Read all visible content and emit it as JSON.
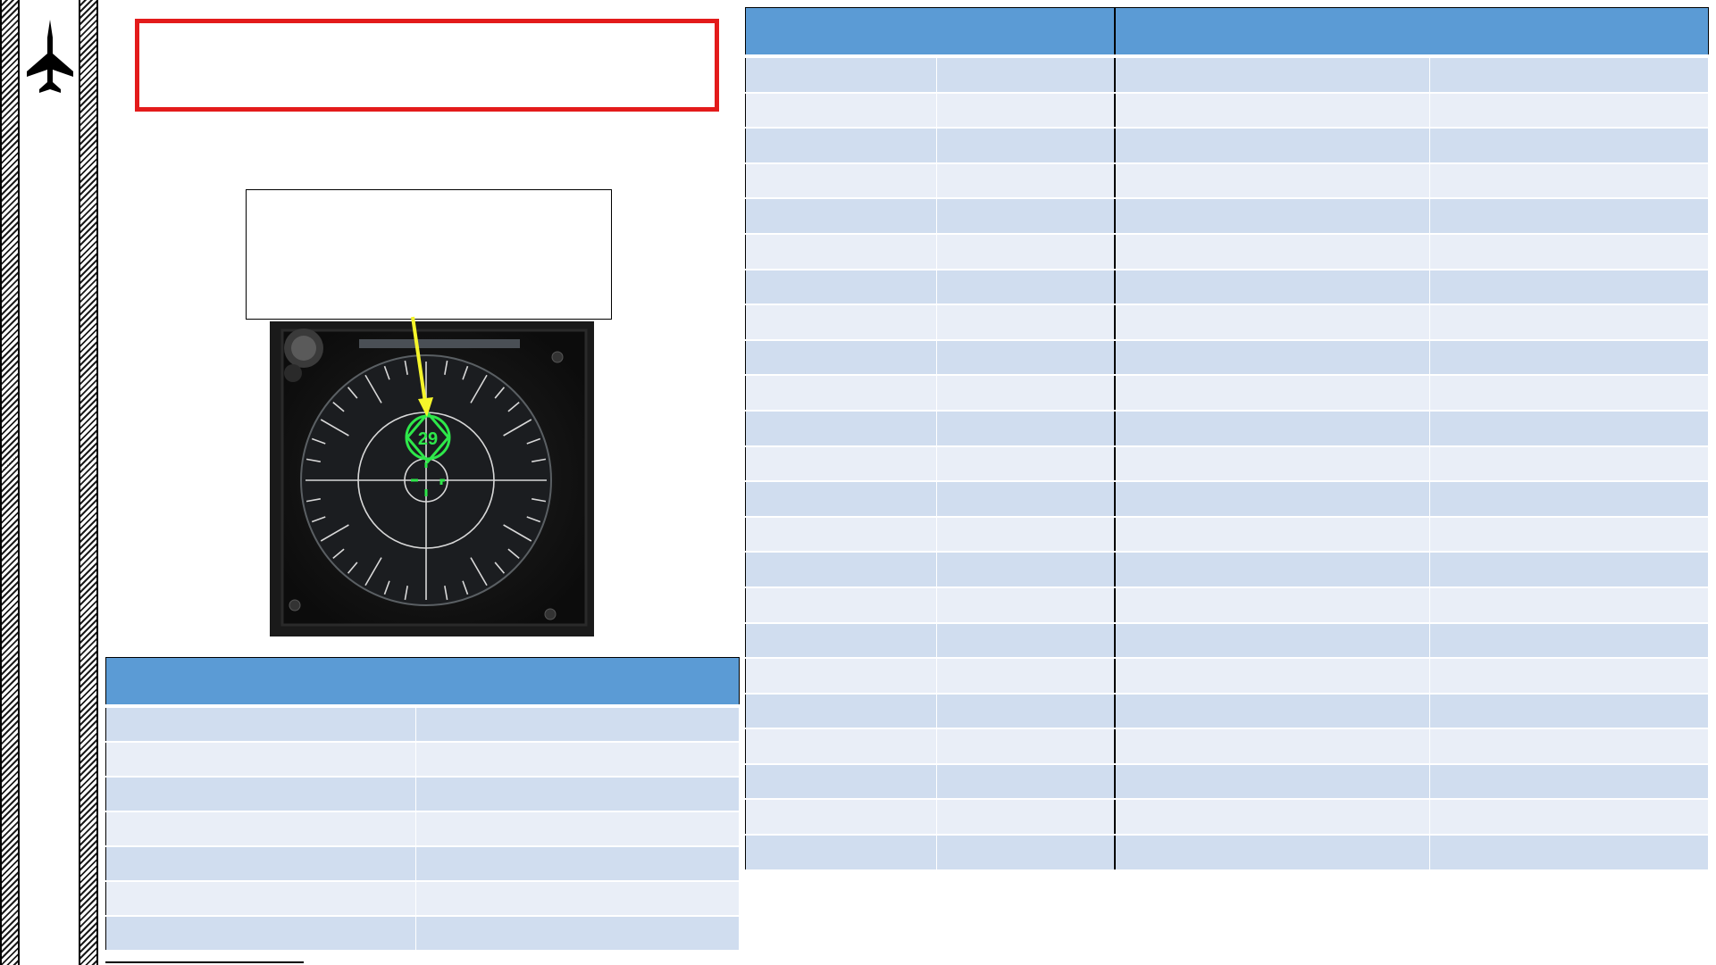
{
  "page": {
    "title": "",
    "callout_text": ""
  },
  "instrument": {
    "name": "radar-indicator",
    "target_symbol_value": "29",
    "screen_color": "#141414",
    "symbol_color": "#2ee84a",
    "pointer_color": "#f5f52a"
  },
  "bottom_table": {
    "header": "",
    "rows": [
      [
        "",
        ""
      ],
      [
        "",
        ""
      ],
      [
        "",
        ""
      ],
      [
        "",
        ""
      ],
      [
        "",
        ""
      ],
      [
        "",
        ""
      ],
      [
        "",
        ""
      ]
    ]
  },
  "right_table": {
    "headers": [
      "",
      ""
    ],
    "rows": [
      [
        "",
        "",
        "",
        ""
      ],
      [
        "",
        "",
        "",
        ""
      ],
      [
        "",
        "",
        "",
        ""
      ],
      [
        "",
        "",
        "",
        ""
      ],
      [
        "",
        "",
        "",
        ""
      ],
      [
        "",
        "",
        "",
        ""
      ],
      [
        "",
        "",
        "",
        ""
      ],
      [
        "",
        "",
        "",
        ""
      ],
      [
        "",
        "",
        "",
        ""
      ],
      [
        "",
        "",
        "",
        ""
      ],
      [
        "",
        "",
        "",
        ""
      ],
      [
        "",
        "",
        "",
        ""
      ],
      [
        "",
        "",
        "",
        ""
      ],
      [
        "",
        "",
        "",
        ""
      ],
      [
        "",
        "",
        "",
        ""
      ],
      [
        "",
        "",
        "",
        ""
      ],
      [
        "",
        "",
        "",
        ""
      ],
      [
        "",
        "",
        "",
        ""
      ],
      [
        "",
        "",
        "",
        ""
      ],
      [
        "",
        "",
        "",
        ""
      ],
      [
        "",
        "",
        "",
        ""
      ],
      [
        "",
        "",
        "",
        ""
      ],
      [
        "",
        "",
        "",
        ""
      ]
    ]
  },
  "colors": {
    "header_blue": "#5b9bd5",
    "row_dark": "#d0ddef",
    "row_light": "#e9eef7",
    "title_border": "#e31b1b"
  },
  "icons": {
    "logo": "fighter-jet-icon"
  }
}
